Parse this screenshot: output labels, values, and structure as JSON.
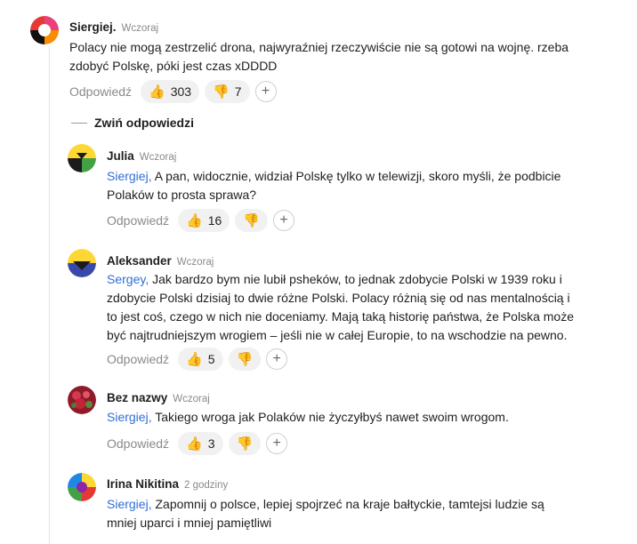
{
  "ui": {
    "reply_label": "Odpowiedź",
    "collapse_label": "Zwiń odpowiedzi",
    "plus_glyph": "+",
    "thumb_up_glyph": "👍",
    "thumb_down_glyph": "👎"
  },
  "colors": {
    "mention": "#2f6fd6",
    "reaction": "#f4b400",
    "muted": "#8a8a8a"
  },
  "comments": [
    {
      "author": "Siergiej.",
      "time": "Wczoraj",
      "lines": [
        "Polacy nie mogą zestrzelić drona, najwyraźniej rzeczywiście nie są gotowi na wojnę. rzeba",
        "zdobyć Polskę, póki jest czas xDDDD"
      ],
      "likes": "303",
      "dislikes": "7"
    },
    {
      "author": "Julia",
      "time": "Wczoraj",
      "mention": "Siergiej,",
      "lines": [
        " A pan, widocznie, widział Polskę tylko w telewizji, skoro myśli, że podbicie",
        "Polaków to prosta sprawa?"
      ],
      "likes": "16"
    },
    {
      "author": "Aleksander",
      "time": "Wczoraj",
      "mention": "Sergey,",
      "lines": [
        " Jak bardzo bym nie lubił psheków, to jednak zdobycie Polski w 1939 roku i",
        "zdobycie Polski dzisiaj to dwie różne Polski. Polacy różnią się od nas mentalnością i",
        "to jest coś, czego w nich nie doceniamy. Mają taką historię państwa, że Polska może",
        "być najtrudniejszym wrogiem – jeśli nie w całej Europie, to na wschodzie na pewno."
      ],
      "likes": "5"
    },
    {
      "author": "Bez nazwy",
      "time": "Wczoraj",
      "mention": "Siergiej,",
      "lines": [
        " Takiego wroga jak Polaków nie życzyłbyś nawet swoim wrogom."
      ],
      "likes": "3"
    },
    {
      "author": "Irina Nikitina",
      "time": "2 godziny",
      "mention": "Siergiej,",
      "lines": [
        " Zapomnij o polsce, lepiej spojrzeć na kraje bałtyckie, tamtejsi ludzie są",
        "mniej uparci i mniej pamiętliwi"
      ]
    }
  ]
}
